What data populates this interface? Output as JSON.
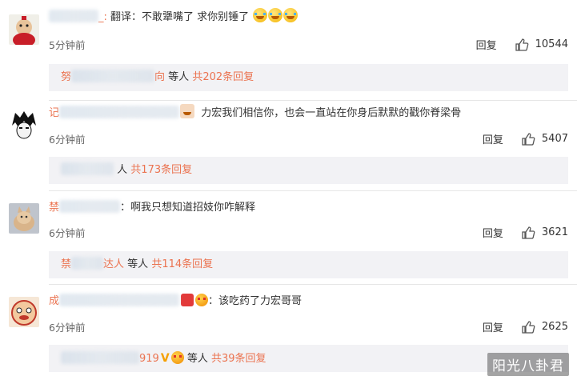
{
  "colors": {
    "accent": "#eb7350",
    "reply_bg": "#f2f2f5",
    "text": "#333333",
    "muted": "#666666"
  },
  "comments": [
    {
      "name_visible": "_:",
      "text": "翻译：不敢犟嘴了 求你别锤了",
      "time": "5分钟前",
      "reply_label": "回复",
      "likes": "10544",
      "replies": {
        "partial_name": "努",
        "partial_suffix": "向",
        "others": "等人",
        "count_label": "共202条回复"
      }
    },
    {
      "name_visible": "记",
      "text": "力宏我们相信你，也会一直站在你身后默默的戳你脊梁骨",
      "time": "6分钟前",
      "reply_label": "回复",
      "likes": "5407",
      "replies": {
        "partial_name": "",
        "partial_suffix": "",
        "others": "人",
        "count_label": "共173条回复"
      }
    },
    {
      "name_visible": "禁",
      "text": "啊我只想知道招妓你咋解释",
      "time": "6分钟前",
      "reply_label": "回复",
      "likes": "3621",
      "replies": {
        "partial_name": "禁",
        "partial_suffix": "达人",
        "others": "等人",
        "count_label": "共114条回复"
      }
    },
    {
      "name_visible": "成",
      "text": "该吃药了力宏哥哥",
      "time": "6分钟前",
      "reply_label": "回复",
      "likes": "2625",
      "replies": {
        "partial_name": "",
        "partial_suffix": "919",
        "others": "等人",
        "count_label": "共39条回复"
      }
    }
  ],
  "watermark": "阳光八卦君"
}
